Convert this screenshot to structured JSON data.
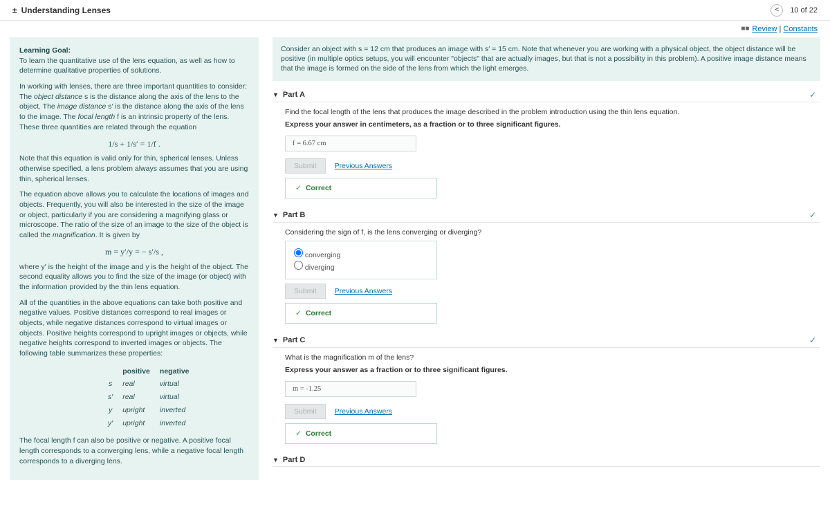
{
  "header": {
    "collapse_icon": "±",
    "title": "Understanding Lenses",
    "prev_icon": "<",
    "progress": "10 of 22"
  },
  "subhead": {
    "flag": "■■",
    "review": "Review",
    "constants": "Constants"
  },
  "left": {
    "goal_label": "Learning Goal:",
    "goal_text": "To learn the quantitative use of the lens equation, as well as how to determine qualitative properties of solutions.",
    "p1a": "In working with lenses, there are three important quantities to consider: The ",
    "p1b": "object distance",
    "p1c": " s is the distance along the axis of the lens to the object. The ",
    "p1d": "image distance",
    "p1e": " s′ is the distance along the axis of the lens to the image. The ",
    "p1f": "focal length",
    "p1g": " f is an intrinsic property of the lens. These three quantities are related through the equation",
    "eq1": "1/s + 1/s′ = 1/f .",
    "p2": "Note that this equation is valid only for thin, spherical lenses. Unless otherwise specified, a lens problem always assumes that you are using thin, spherical lenses.",
    "p3a": "The equation above allows you to calculate the locations of images and objects. Frequently, you will also be interested in the size of the image or object, particularly if you are considering a magnifying glass or microscope. The ratio of the size of an image to the size of the object is called the ",
    "p3b": "magnification",
    "p3c": ". It is given by",
    "eq2": "m = y′/y = − s′/s ,",
    "p4": "where y′ is the height of the image and y is the height of the object. The second equality allows you to find the size of the image (or object) with the information provided by the thin lens equation.",
    "p5": "All of the quantities in the above equations can take both positive and negative values. Positive distances correspond to real images or objects, while negative distances correspond to virtual images or objects. Positive heights correspond to upright images or objects, while negative heights correspond to inverted images or objects. The following table summarizes these properties:",
    "table": {
      "hpos": "positive",
      "hneg": "negative",
      "r1": {
        "v": "s",
        "p": "real",
        "n": "virtual"
      },
      "r2": {
        "v": "s′",
        "p": "real",
        "n": "virtual"
      },
      "r3": {
        "v": "y",
        "p": "upright",
        "n": "inverted"
      },
      "r4": {
        "v": "y′",
        "p": "upright",
        "n": "inverted"
      }
    },
    "p6": "The focal length f can also be positive or negative. A positive focal length corresponds to a converging lens, while a negative focal length corresponds to a diverging lens."
  },
  "intro": "Consider an object with s = 12 cm that produces an image with s′ = 15 cm. Note that whenever you are working with a physical object, the object distance will be positive (in multiple optics setups, you will encounter \"objects\" that are actually images, but that is not a possibility in this problem). A positive image distance means that the image is formed on the side of the lens from which the light emerges.",
  "parts": {
    "a": {
      "label": "Part A",
      "q": "Find the focal length of the lens that produces the image described in the problem introduction using the thin lens equation.",
      "instr": "Express your answer in centimeters, as a fraction or to three significant figures.",
      "ans": "f = 6.67 cm"
    },
    "b": {
      "label": "Part B",
      "q": "Considering the sign of f, is the lens converging or diverging?",
      "opt1": "converging",
      "opt2": "diverging"
    },
    "c": {
      "label": "Part C",
      "q": "What is the magnification m of the lens?",
      "instr": "Express your answer as a fraction or to three significant figures.",
      "ans": "m = -1.25"
    },
    "d": {
      "label": "Part D"
    }
  },
  "common": {
    "submit": "Submit",
    "prev": "Previous Answers",
    "correct": "Correct",
    "check": "✓",
    "caret": "▼"
  }
}
